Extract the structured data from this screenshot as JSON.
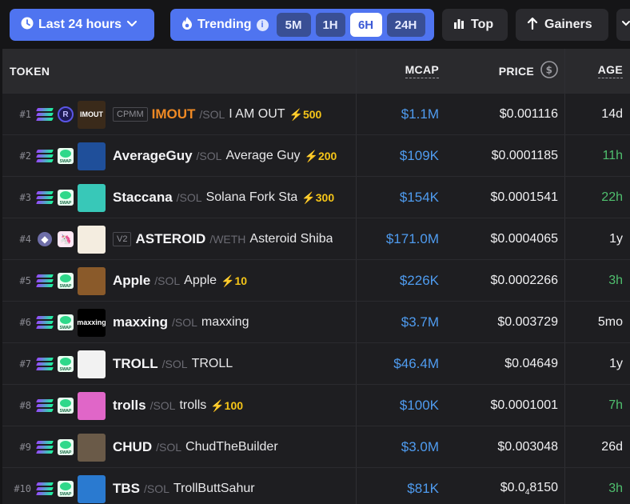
{
  "toolbar": {
    "time_filter": "Last 24 hours",
    "trending_label": "Trending",
    "intervals": [
      "5M",
      "1H",
      "6H",
      "24H"
    ],
    "active_interval": "6H",
    "top_label": "Top",
    "gainers_label": "Gainers"
  },
  "columns": {
    "token": "TOKEN",
    "mcap": "MCAP",
    "price": "PRICE",
    "age": "AGE"
  },
  "rows": [
    {
      "rank": "#1",
      "chain": "sol",
      "dex": "raydium",
      "avatar_label": "IMOUT",
      "tag": "CPMM",
      "symbol": "IMOUT",
      "pair": "/SOL",
      "name": "I AM OUT",
      "boost": "⚡500",
      "mcap": "$1.1M",
      "price": "$0.001116",
      "age": "14d",
      "age_color": "#f0f0f2"
    },
    {
      "rank": "#2",
      "chain": "sol",
      "dex": "swap",
      "avatar_label": "",
      "tag": "",
      "symbol": "AverageGuy",
      "pair": "/SOL",
      "name": "Average Guy",
      "boost": "⚡200",
      "mcap": "$109K",
      "price": "$0.0001185",
      "age": "11h",
      "age_color": "#4fbf6e"
    },
    {
      "rank": "#3",
      "chain": "sol",
      "dex": "swap",
      "avatar_label": "",
      "tag": "",
      "symbol": "Staccana",
      "pair": "/SOL",
      "name": "Solana Fork Sta",
      "boost": "⚡300",
      "mcap": "$154K",
      "price": "$0.0001541",
      "age": "22h",
      "age_color": "#4fbf6e"
    },
    {
      "rank": "#4",
      "chain": "eth",
      "dex": "uniswap",
      "avatar_label": "",
      "tag": "V2",
      "symbol": "ASTEROID",
      "pair": "/WETH",
      "name": "Asteroid Shiba",
      "boost": "",
      "mcap": "$171.0M",
      "price": "$0.0004065",
      "age": "1y",
      "age_color": "#f0f0f2"
    },
    {
      "rank": "#5",
      "chain": "sol",
      "dex": "swap",
      "avatar_label": "",
      "tag": "",
      "symbol": "Apple",
      "pair": "/SOL",
      "name": "Apple",
      "boost": "⚡10",
      "mcap": "$226K",
      "price": "$0.0002266",
      "age": "3h",
      "age_color": "#4fbf6e"
    },
    {
      "rank": "#6",
      "chain": "sol",
      "dex": "swap",
      "avatar_label": "maxxing",
      "tag": "",
      "symbol": "maxxing",
      "pair": "/SOL",
      "name": "maxxing",
      "boost": "",
      "mcap": "$3.7M",
      "price": "$0.003729",
      "age": "5mo",
      "age_color": "#f0f0f2"
    },
    {
      "rank": "#7",
      "chain": "sol",
      "dex": "swap",
      "avatar_label": "",
      "tag": "",
      "symbol": "TROLL",
      "pair": "/SOL",
      "name": "TROLL",
      "boost": "",
      "mcap": "$46.4M",
      "price": "$0.04649",
      "age": "1y",
      "age_color": "#f0f0f2"
    },
    {
      "rank": "#8",
      "chain": "sol",
      "dex": "swap",
      "avatar_label": "",
      "tag": "",
      "symbol": "trolls",
      "pair": "/SOL",
      "name": "trolls",
      "boost": "⚡100",
      "mcap": "$100K",
      "price": "$0.0001001",
      "age": "7h",
      "age_color": "#4fbf6e"
    },
    {
      "rank": "#9",
      "chain": "sol",
      "dex": "swap",
      "avatar_label": "",
      "tag": "",
      "symbol": "CHUD",
      "pair": "/SOL",
      "name": "ChudTheBuilder",
      "boost": "",
      "mcap": "$3.0M",
      "price": "$0.003048",
      "age": "26d",
      "age_color": "#f0f0f2"
    },
    {
      "rank": "#10",
      "chain": "sol",
      "dex": "swap",
      "avatar_label": "",
      "tag": "",
      "symbol": "TBS",
      "pair": "/SOL",
      "name": "TrollButtSahur",
      "boost": "",
      "mcap": "$81K",
      "price_prefix": "$0.0",
      "price_sub": "4",
      "price_suffix": "8150",
      "price": "",
      "age": "3h",
      "age_color": "#4fbf6e"
    }
  ],
  "avatar_colors": [
    "#3a2a1a",
    "#1f4f9a",
    "#38c8b8",
    "#f4ede0",
    "#8a5a2a",
    "#000000",
    "#f2f2f2",
    "#e066c8",
    "#6a5a48",
    "#2a7ad0"
  ]
}
